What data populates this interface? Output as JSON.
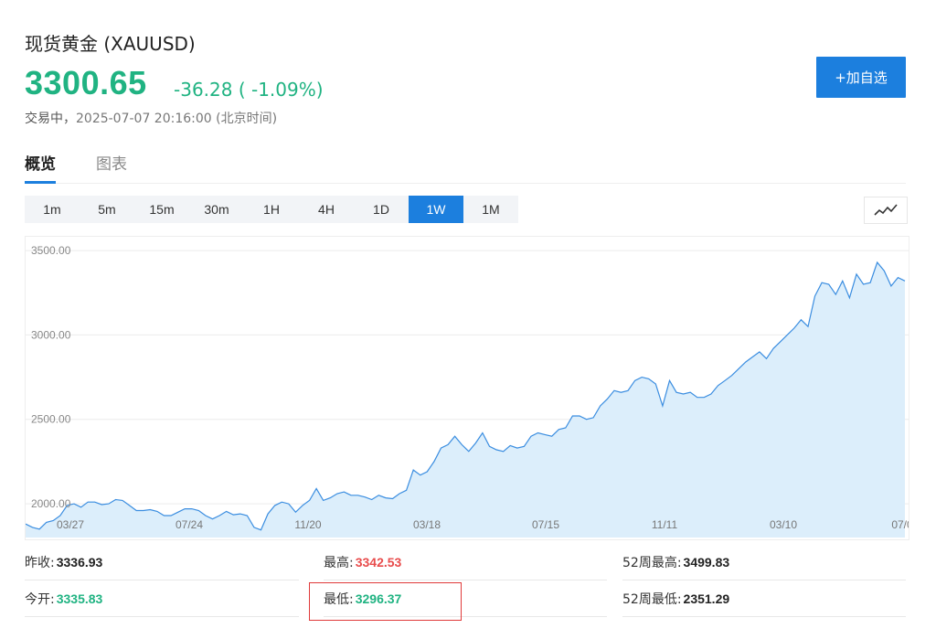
{
  "header": {
    "title": "现货黄金  (XAUUSD)",
    "price": "3300.65",
    "change": "-36.28 ( -1.09%)",
    "status_label": "交易中，",
    "timestamp": "2025-07-07 20:16:00  (北京时间)",
    "follow_button": "+加自选"
  },
  "tabs": [
    {
      "label": "概览",
      "active": true
    },
    {
      "label": "图表",
      "active": false
    }
  ],
  "periods": [
    {
      "label": "1m",
      "active": false
    },
    {
      "label": "5m",
      "active": false
    },
    {
      "label": "15m",
      "active": false
    },
    {
      "label": "30m",
      "active": false
    },
    {
      "label": "1H",
      "active": false
    },
    {
      "label": "4H",
      "active": false
    },
    {
      "label": "1D",
      "active": false
    },
    {
      "label": "1W",
      "active": true
    },
    {
      "label": "1M",
      "active": false
    }
  ],
  "chart_type_icon": "line-chart-icon",
  "chart_data": {
    "type": "area",
    "ylim": [
      1800,
      3560
    ],
    "yticks": [
      "3500.00",
      "3000.00",
      "2500.00",
      "2000.00"
    ],
    "xtick_labels": [
      "03/27",
      "07/24",
      "11/20",
      "03/18",
      "07/15",
      "11/11",
      "03/10",
      "07/0"
    ],
    "xlabel": "",
    "ylabel": "",
    "grid": true,
    "series": [
      {
        "values": [
          1880,
          1860,
          1850,
          1890,
          1900,
          1930,
          1990,
          2000,
          1980,
          2010,
          2010,
          1995,
          2000,
          2025,
          2020,
          1990,
          1960,
          1960,
          1965,
          1955,
          1930,
          1930,
          1950,
          1970,
          1970,
          1960,
          1930,
          1910,
          1930,
          1955,
          1935,
          1940,
          1930,
          1860,
          1845,
          1940,
          1990,
          2010,
          2000,
          1950,
          1990,
          2020,
          2090,
          2020,
          2035,
          2060,
          2070,
          2050,
          2050,
          2040,
          2025,
          2050,
          2035,
          2030,
          2060,
          2080,
          2200,
          2170,
          2190,
          2250,
          2330,
          2350,
          2400,
          2350,
          2310,
          2360,
          2420,
          2340,
          2320,
          2310,
          2345,
          2330,
          2340,
          2400,
          2420,
          2410,
          2400,
          2440,
          2450,
          2520,
          2520,
          2500,
          2510,
          2580,
          2620,
          2670,
          2660,
          2670,
          2730,
          2750,
          2740,
          2710,
          2580,
          2730,
          2660,
          2650,
          2660,
          2630,
          2630,
          2650,
          2700,
          2730,
          2760,
          2800,
          2840,
          2870,
          2900,
          2860,
          2920,
          2960,
          3000,
          3040,
          3090,
          3050,
          3230,
          3310,
          3300,
          3240,
          3320,
          3220,
          3360,
          3300,
          3310,
          3430,
          3380,
          3290,
          3340,
          3320
        ],
        "color": "#3a8de0",
        "fill": "#dceefb"
      }
    ]
  },
  "stats": [
    [
      {
        "label": "昨收:",
        "value": "3336.93",
        "color": "#222222"
      },
      {
        "label": "最高:",
        "value": "3342.53",
        "color": "#e84c4c"
      },
      {
        "label": "52周最高:",
        "value": "3499.83",
        "color": "#222222"
      }
    ],
    [
      {
        "label": "今开:",
        "value": "3335.83",
        "color": "#20b382"
      },
      {
        "label": "最低:",
        "value": "3296.37",
        "color": "#20b382"
      },
      {
        "label": "52周最低:",
        "value": "2351.29",
        "color": "#222222"
      }
    ]
  ],
  "colors": {
    "up_green": "#20b382",
    "down_red": "#e84c4c",
    "accent_blue": "#1c7fde"
  }
}
